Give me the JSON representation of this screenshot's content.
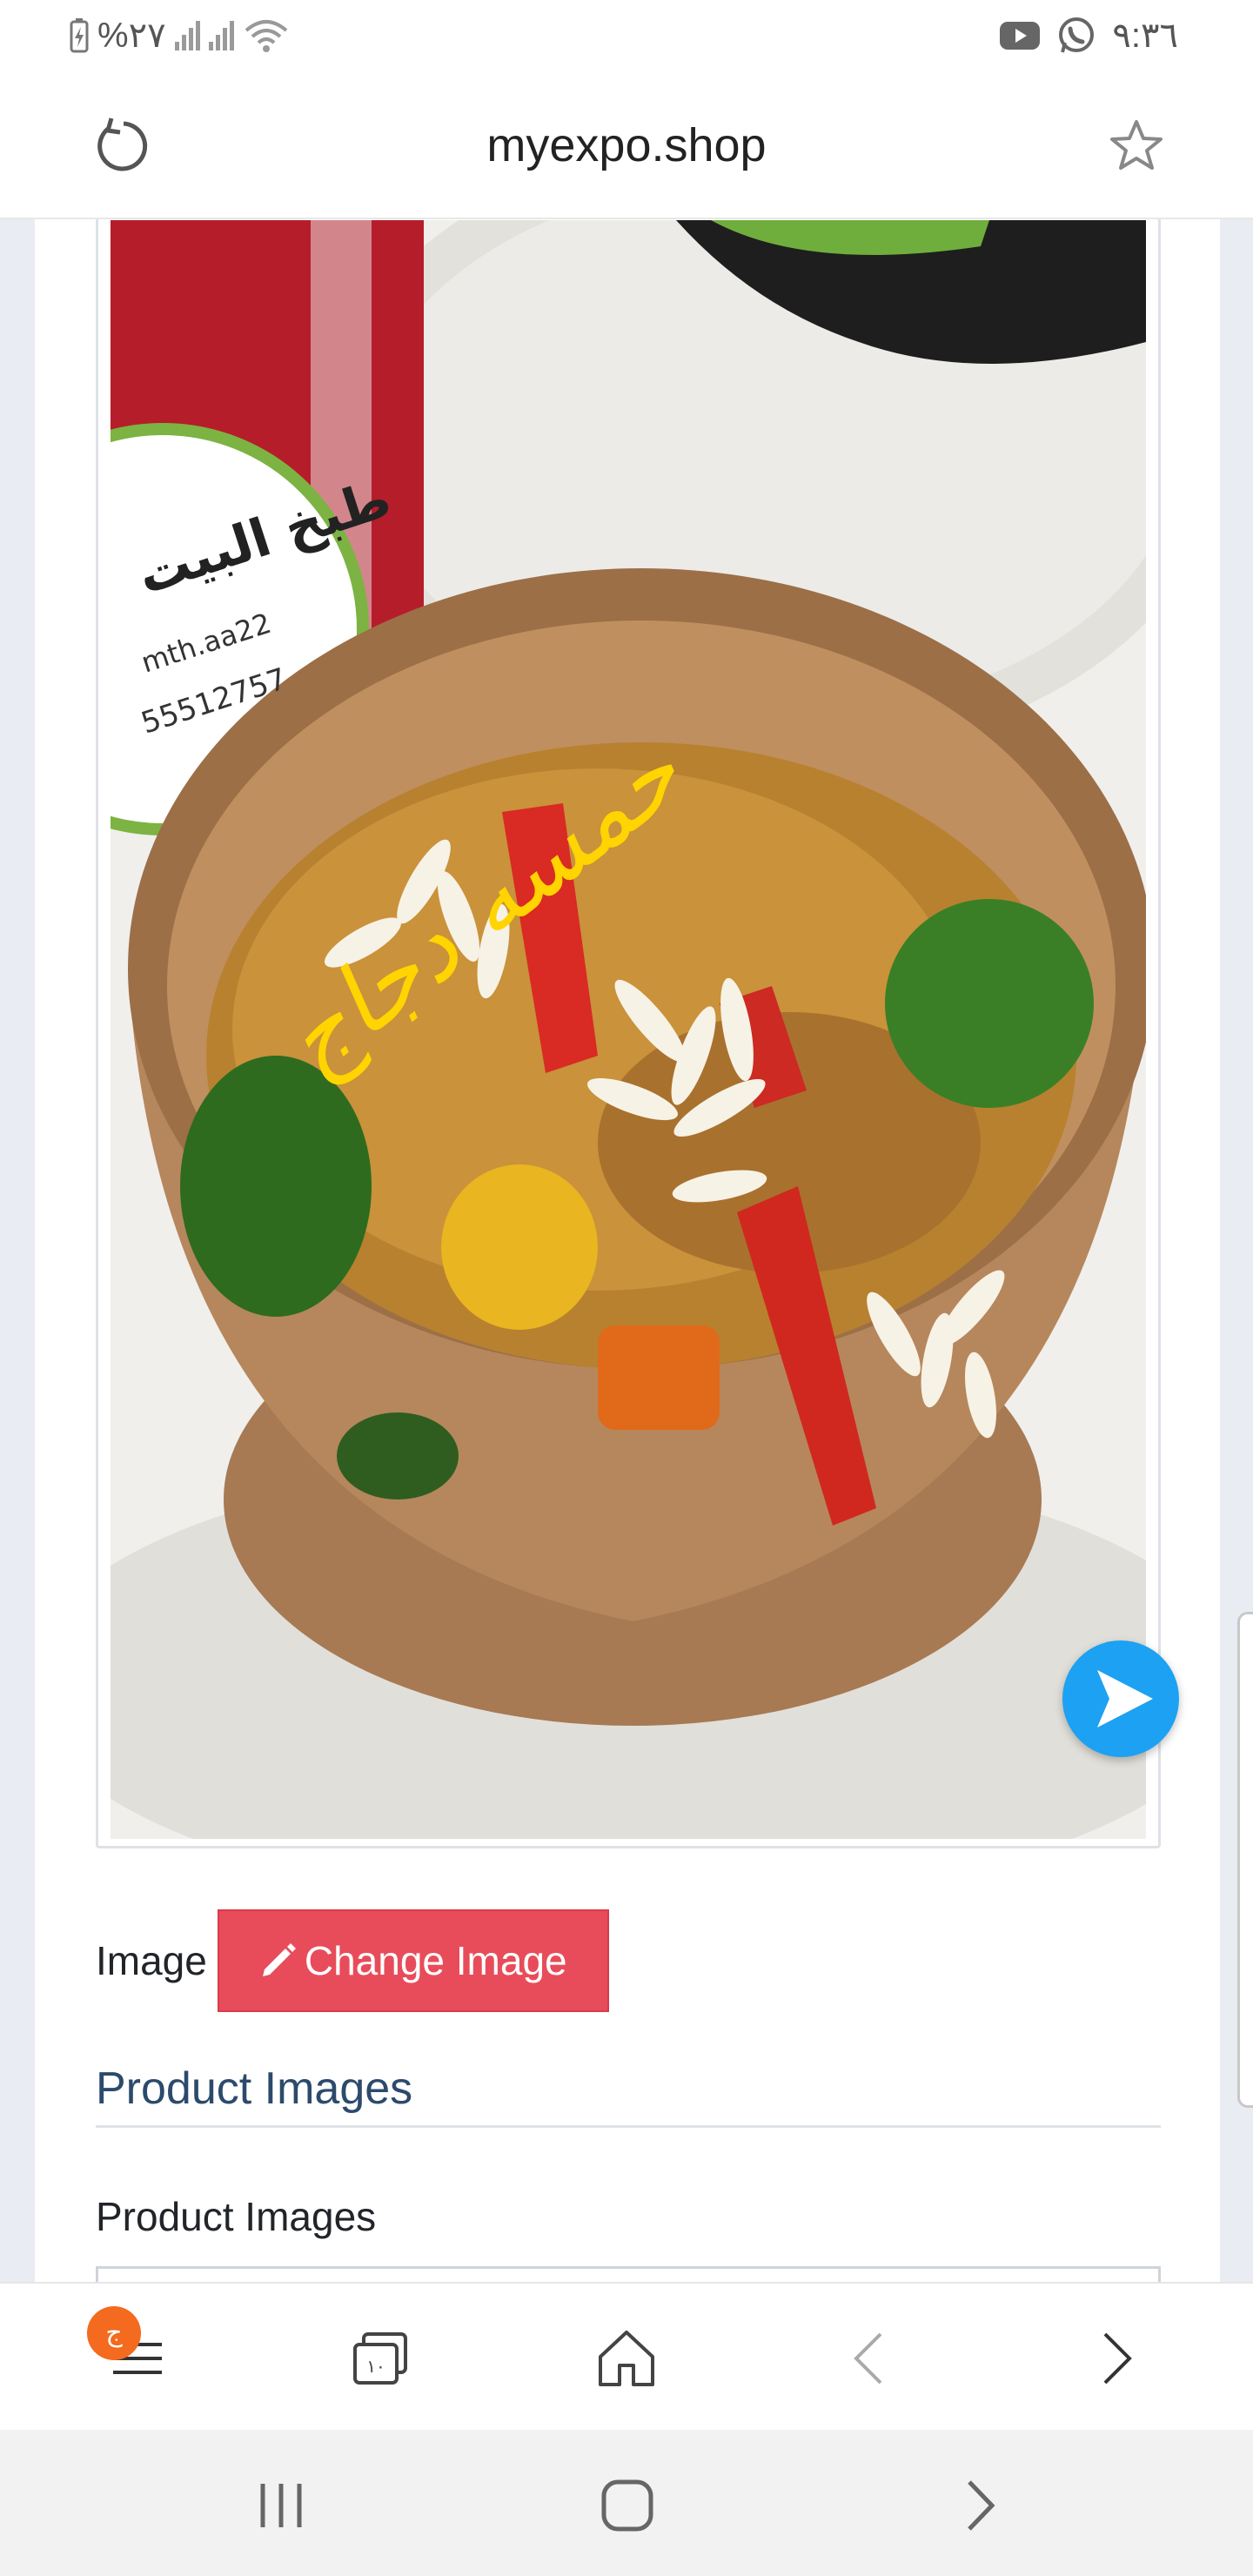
{
  "status_bar": {
    "battery_percent": "%٢٧",
    "time": "٩:٣٦",
    "icons": [
      "battery-icon",
      "signal-icon",
      "signal-icon",
      "wifi-icon",
      "youtube-icon",
      "whatsapp-icon"
    ]
  },
  "url_bar": {
    "url": "myexpo.shop"
  },
  "product": {
    "photo_handwritten_caption": "حمسه دجاج",
    "photo_sticker_lines": [
      "طبخ البيت",
      "mth.aa22",
      "55512757"
    ],
    "image_label": "Image",
    "change_image_label": "Change Image",
    "section_title": "Product Images",
    "field_label": "Product Images"
  },
  "toolbar": {
    "badge": "ج",
    "tabs_count": "١٠"
  },
  "colors": {
    "change_button": "#e84c5a",
    "section_title": "#2c4a6b",
    "page_background": "#e9ecf2",
    "play_button": "#1da1f2",
    "badge": "#f46a1e"
  }
}
